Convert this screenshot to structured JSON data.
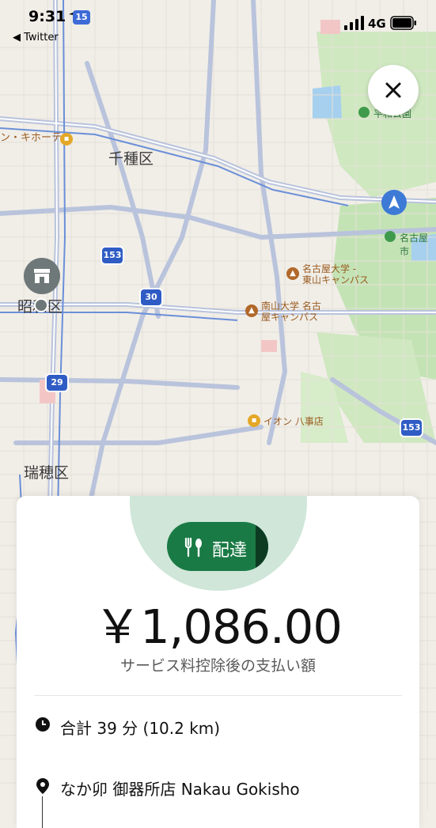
{
  "status_bar": {
    "time": "9:31",
    "route_badge": "15",
    "back_label": "◀ Twitter",
    "network": "4G"
  },
  "map": {
    "areas": [
      "千種区",
      "昭和区",
      "瑞穂区"
    ],
    "pois": [
      "ン・キホーテ",
      "名古屋大学 -",
      "東山キャンパス",
      "南山大学 名古",
      "屋キャンパス",
      "イオン 八事店"
    ],
    "parks": [
      "平和公園",
      "名古屋市"
    ],
    "route_shields": [
      "153",
      "30",
      "29",
      "153"
    ]
  },
  "card": {
    "mode_label": "配達",
    "amount": "￥1,086.00",
    "amount_caption": "サービス料控除後の支払い額",
    "summary": "合計 39 分 (10.2 km)",
    "pickup": "なか卯 御器所店 Nakau Gokisho"
  },
  "colors": {
    "accent_green": "#1a7a45",
    "circle_green": "#cfe6d9",
    "map_blue": "#3d7ad6"
  }
}
